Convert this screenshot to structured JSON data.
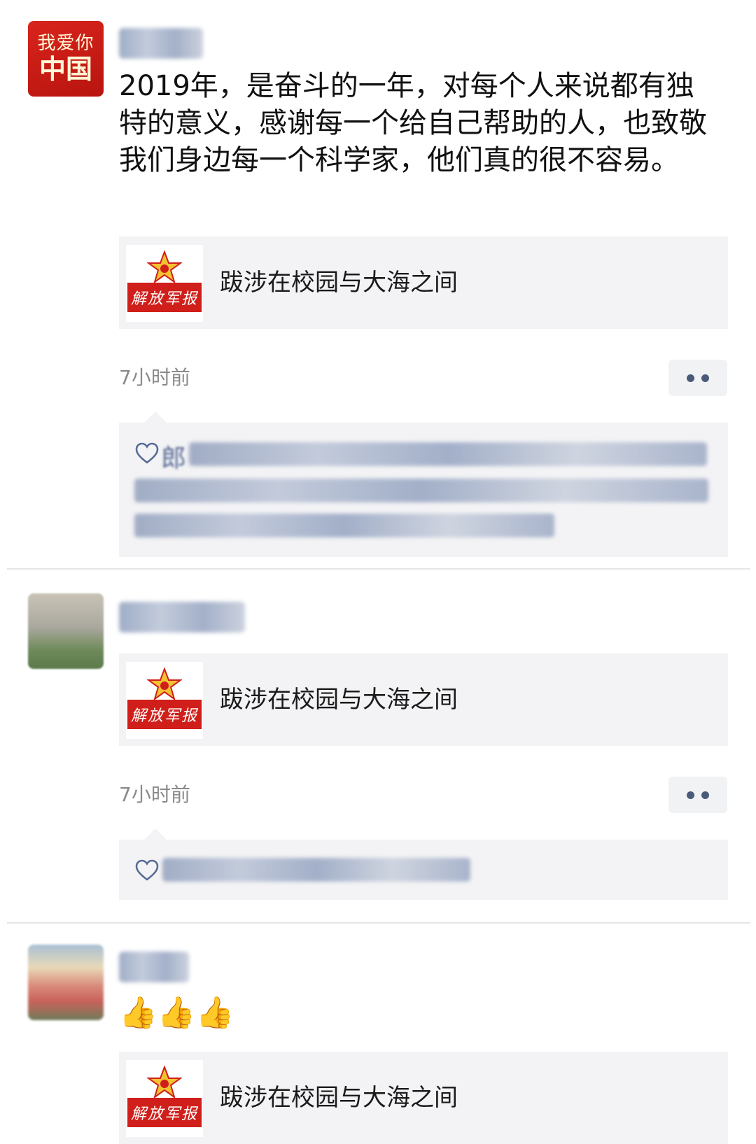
{
  "posts": [
    {
      "avatar": {
        "line1": "我爱你",
        "line2": "中国"
      },
      "text": "2019年，是奋斗的一年，对每个人来说都有独特的意义，感谢每一个给自己帮助的人，也致敬我们身边每一个科学家，他们真的很不容易。",
      "link": {
        "logo_text": "解放军报",
        "title": "跋涉在校园与大海之间"
      },
      "time": "7小时前",
      "likes": {
        "first_name": "郎"
      }
    },
    {
      "link": {
        "logo_text": "解放军报",
        "title": "跋涉在校园与大海之间"
      },
      "time": "7小时前"
    },
    {
      "emoji": "👍👍👍",
      "link": {
        "logo_text": "解放军报",
        "title": "跋涉在校园与大海之间"
      }
    }
  ],
  "colors": {
    "link_blue": "#576b95",
    "card_bg": "#f3f3f5",
    "logo_red": "#d01f1a"
  },
  "icons": {
    "more": "more-dots-icon",
    "like": "heart-outline-icon",
    "emoji": "thumbs-up-icon"
  }
}
